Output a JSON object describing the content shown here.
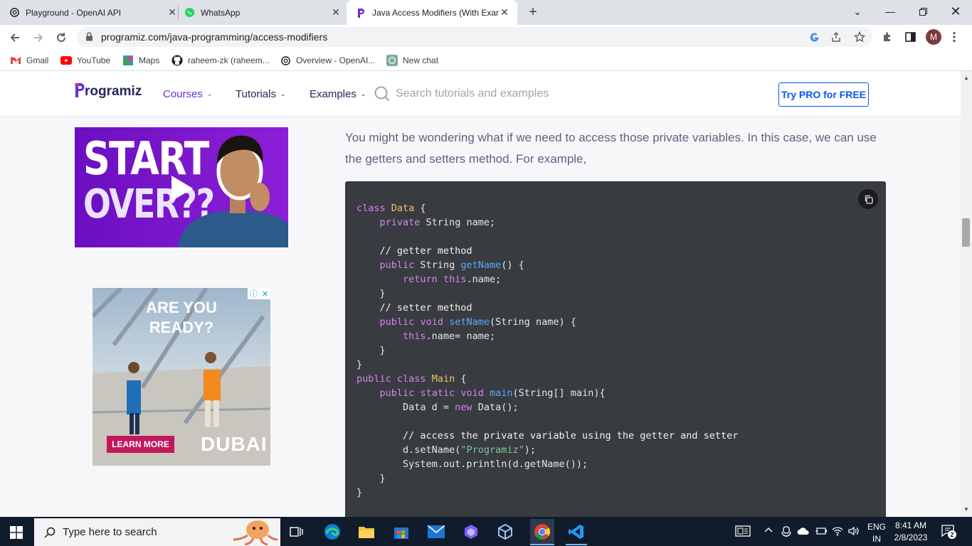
{
  "browser": {
    "tabs": [
      {
        "title": "Playground - OpenAI API",
        "icon": "openai-icon"
      },
      {
        "title": "WhatsApp",
        "icon": "whatsapp-icon"
      },
      {
        "title": "Java Access Modifiers (With Exan",
        "icon": "programiz-icon",
        "active": true
      }
    ],
    "url": "programiz.com/java-programming/access-modifiers",
    "profile_initial": "M",
    "bookmarks": [
      "Gmail",
      "YouTube",
      "Maps",
      "raheem-zk (raheem...",
      "Overview - OpenAI...",
      "New chat"
    ]
  },
  "site": {
    "logo_text": "rogramiz",
    "nav": [
      "Courses",
      "Tutorials",
      "Examples"
    ],
    "search_placeholder": "Search tutorials and examples",
    "pro_button": "Try PRO for FREE",
    "accent_color": "#0556f3",
    "brand_color": "#25265e"
  },
  "banner_ad": {
    "line1": "START",
    "line2": "OVER??"
  },
  "side_ad": {
    "headline_1": "ARE YOU",
    "headline_2": "READY?",
    "cta": "LEARN MORE",
    "brand": "DUBAI"
  },
  "article": {
    "paragraph": "You might be wondering what if we need to access those private variables. In this case, we can use the getters and setters method. For example,"
  },
  "code": {
    "language": "java",
    "lines": [
      "class Data {",
      "    private String name;",
      "",
      "    // getter method",
      "    public String getName() {",
      "        return this.name;",
      "    }",
      "    // setter method",
      "    public void setName(String name) {",
      "        this.name= name;",
      "    }",
      "}",
      "public class Main {",
      "    public static void main(String[] main){",
      "        Data d = new Data();",
      "",
      "        // access the private variable using the getter and setter",
      "        d.setName(\"Programiz\");",
      "        System.out.println(d.getName());",
      "    }",
      "}"
    ]
  },
  "taskbar": {
    "search_placeholder": "Type here to search",
    "lang_1": "ENG",
    "lang_2": "IN",
    "time": "8:41 AM",
    "date": "2/8/2023",
    "notifications": "2"
  }
}
